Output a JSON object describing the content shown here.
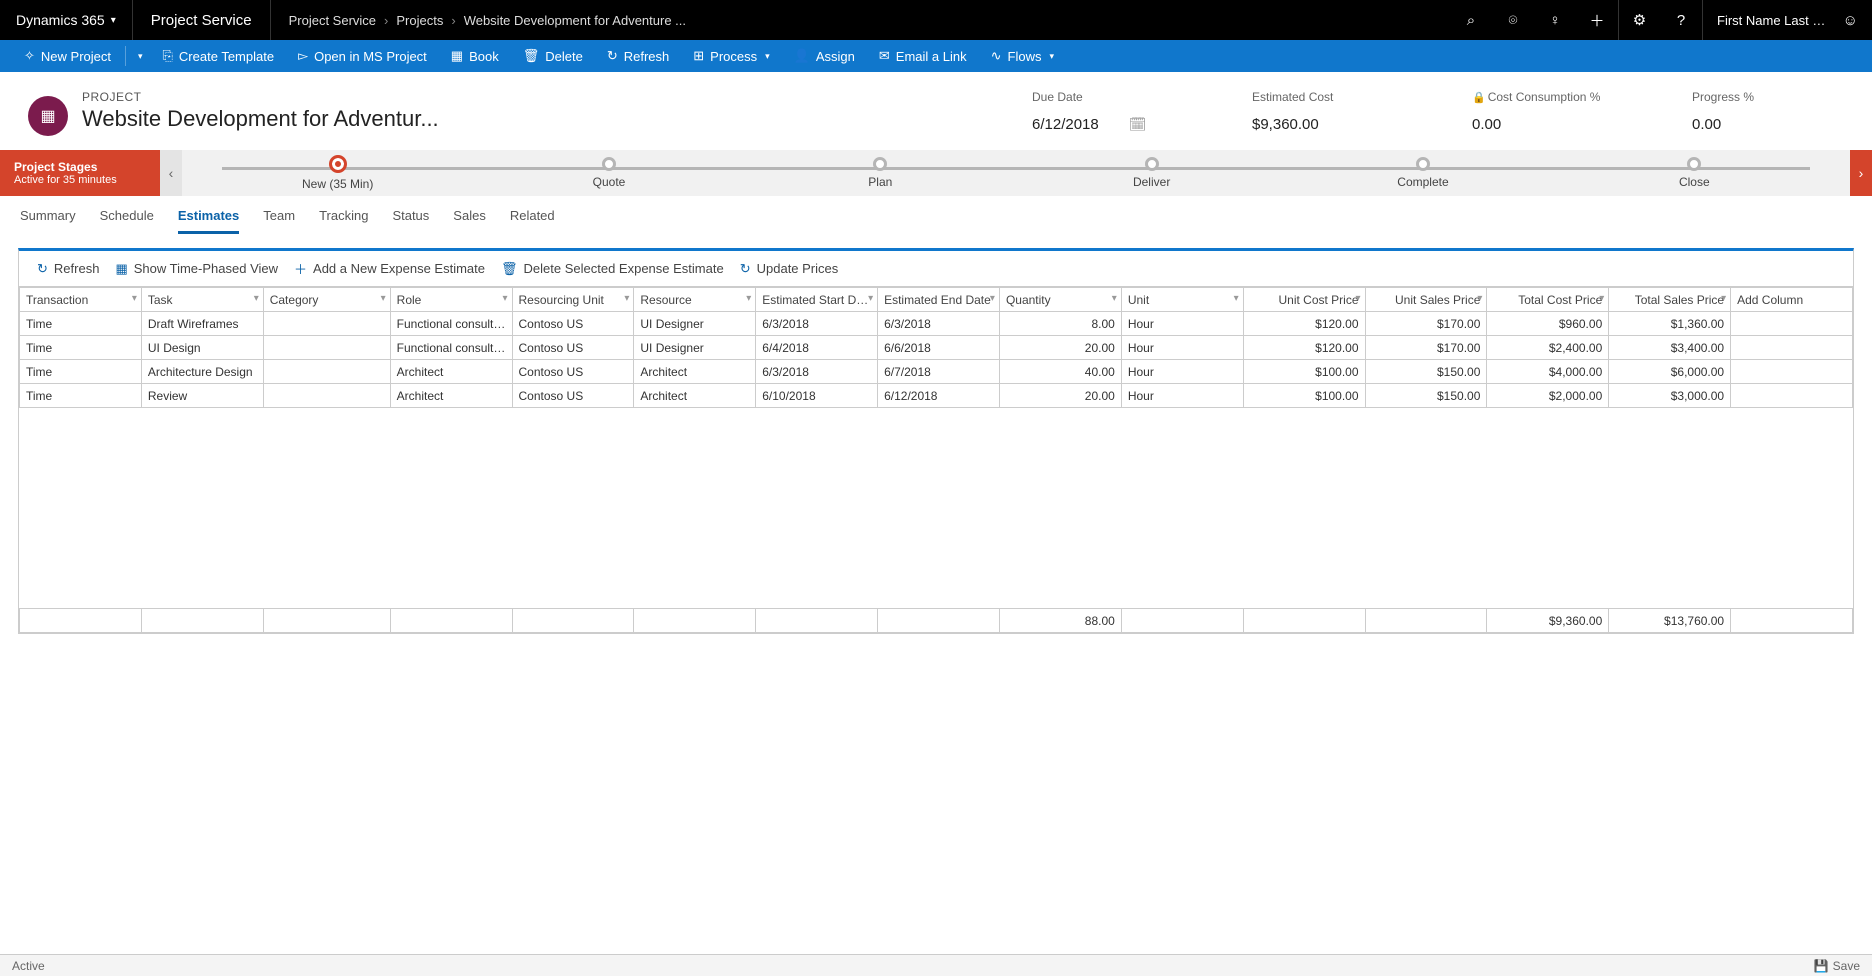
{
  "topbar": {
    "brand": "Dynamics 365",
    "app": "Project Service",
    "breadcrumb": [
      "Project Service",
      "Projects",
      "Website Development for Adventure ..."
    ],
    "user": "First Name Last Na..."
  },
  "cmdbar": {
    "new_project": "New Project",
    "create_template": "Create Template",
    "open_msp": "Open in MS Project",
    "book": "Book",
    "delete": "Delete",
    "refresh": "Refresh",
    "process": "Process",
    "assign": "Assign",
    "email_link": "Email a Link",
    "flows": "Flows"
  },
  "record": {
    "type": "PROJECT",
    "name": "Website Development for Adventur...",
    "fields": {
      "due_date_label": "Due Date",
      "due_date": "6/12/2018",
      "est_cost_label": "Estimated Cost",
      "est_cost": "$9,360.00",
      "cost_cons_label": "Cost Consumption %",
      "cost_cons": "0.00",
      "progress_label": "Progress %",
      "progress": "0.00"
    }
  },
  "process": {
    "title": "Project Stages",
    "subtitle": "Active for 35 minutes",
    "active_stage": "New  (35 Min)",
    "stages": [
      "New  (35 Min)",
      "Quote",
      "Plan",
      "Deliver",
      "Complete",
      "Close"
    ]
  },
  "tabs": [
    "Summary",
    "Schedule",
    "Estimates",
    "Team",
    "Tracking",
    "Status",
    "Sales",
    "Related"
  ],
  "active_tab": "Estimates",
  "panel": {
    "toolbar": {
      "refresh": "Refresh",
      "time_phased": "Show Time-Phased View",
      "add_expense": "Add a New Expense Estimate",
      "delete_expense": "Delete Selected Expense Estimate",
      "update_prices": "Update Prices"
    },
    "columns": [
      "Transaction",
      "Task",
      "Category",
      "Role",
      "Resourcing Unit",
      "Resource",
      "Estimated Start Date",
      "Estimated End Date",
      "Quantity",
      "Unit",
      "Unit Cost Price",
      "Unit Sales Price",
      "Total Cost Price",
      "Total Sales Price",
      "Add Column"
    ],
    "rows": [
      {
        "trans": "Time",
        "task": "Draft Wireframes",
        "cat": "",
        "role": "Functional consultant",
        "ru": "Contoso US",
        "res": "UI Designer",
        "esd": "6/3/2018",
        "eed": "6/3/2018",
        "qty": "8.00",
        "unit": "Hour",
        "ucp": "$120.00",
        "usp": "$170.00",
        "tcp": "$960.00",
        "tsp": "$1,360.00"
      },
      {
        "trans": "Time",
        "task": "UI Design",
        "cat": "",
        "role": "Functional consultant",
        "ru": "Contoso US",
        "res": "UI Designer",
        "esd": "6/4/2018",
        "eed": "6/6/2018",
        "qty": "20.00",
        "unit": "Hour",
        "ucp": "$120.00",
        "usp": "$170.00",
        "tcp": "$2,400.00",
        "tsp": "$3,400.00"
      },
      {
        "trans": "Time",
        "task": "Architecture Design",
        "cat": "",
        "role": "Architect",
        "ru": "Contoso US",
        "res": "Architect",
        "esd": "6/3/2018",
        "eed": "6/7/2018",
        "qty": "40.00",
        "unit": "Hour",
        "ucp": "$100.00",
        "usp": "$150.00",
        "tcp": "$4,000.00",
        "tsp": "$6,000.00"
      },
      {
        "trans": "Time",
        "task": "Review",
        "cat": "",
        "role": "Architect",
        "ru": "Contoso US",
        "res": "Architect",
        "esd": "6/10/2018",
        "eed": "6/12/2018",
        "qty": "20.00",
        "unit": "Hour",
        "ucp": "$100.00",
        "usp": "$150.00",
        "tcp": "$2,000.00",
        "tsp": "$3,000.00"
      }
    ],
    "totals": {
      "qty": "88.00",
      "tcp": "$9,360.00",
      "tsp": "$13,760.00"
    }
  },
  "footer": {
    "status": "Active",
    "save": "Save"
  }
}
